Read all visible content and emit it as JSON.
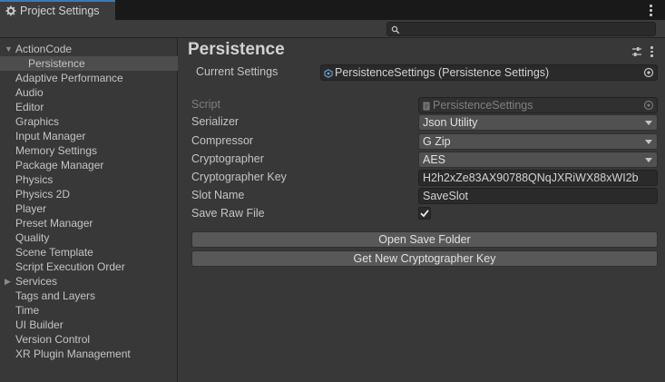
{
  "window": {
    "tab_title": "Project Settings",
    "tab_icon": "gear-icon"
  },
  "search": {
    "value": "",
    "placeholder": ""
  },
  "sidebar": {
    "items": [
      {
        "label": "ActionCode",
        "expanded": true,
        "has_children": true
      },
      {
        "label": "Persistence",
        "selected": true,
        "child": true
      },
      {
        "label": "Adaptive Performance"
      },
      {
        "label": "Audio"
      },
      {
        "label": "Editor"
      },
      {
        "label": "Graphics"
      },
      {
        "label": "Input Manager"
      },
      {
        "label": "Memory Settings"
      },
      {
        "label": "Package Manager"
      },
      {
        "label": "Physics"
      },
      {
        "label": "Physics 2D"
      },
      {
        "label": "Player"
      },
      {
        "label": "Preset Manager"
      },
      {
        "label": "Quality"
      },
      {
        "label": "Scene Template"
      },
      {
        "label": "Script Execution Order"
      },
      {
        "label": "Services",
        "expanded": false,
        "has_children": true
      },
      {
        "label": "Tags and Layers"
      },
      {
        "label": "Time"
      },
      {
        "label": "UI Builder"
      },
      {
        "label": "Version Control"
      },
      {
        "label": "XR Plugin Management"
      }
    ]
  },
  "main": {
    "title": "Persistence",
    "current_settings": {
      "label": "Current Settings",
      "value": "PersistenceSettings (Persistence Settings)"
    },
    "fields": {
      "script": {
        "label": "Script",
        "value": "PersistenceSettings"
      },
      "serializer": {
        "label": "Serializer",
        "value": "Json Utility"
      },
      "compressor": {
        "label": "Compressor",
        "value": "G Zip"
      },
      "cryptographer": {
        "label": "Cryptographer",
        "value": "AES"
      },
      "cryptographer_key": {
        "label": "Cryptographer Key",
        "value": "H2h2xZe83AX90788QNqJXRiWX88xWI2b"
      },
      "slot_name": {
        "label": "Slot Name",
        "value": "SaveSlot"
      },
      "save_raw_file": {
        "label": "Save Raw File",
        "checked": true
      }
    },
    "buttons": {
      "open_save_folder": "Open Save Folder",
      "get_new_key": "Get New Cryptographer Key"
    }
  },
  "colors": {
    "background": "#383838",
    "tab_accent": "#3a79bb",
    "selection": "#4d4d4d",
    "field": "#2a2a2a",
    "dropdown": "#515151",
    "button": "#585858"
  }
}
